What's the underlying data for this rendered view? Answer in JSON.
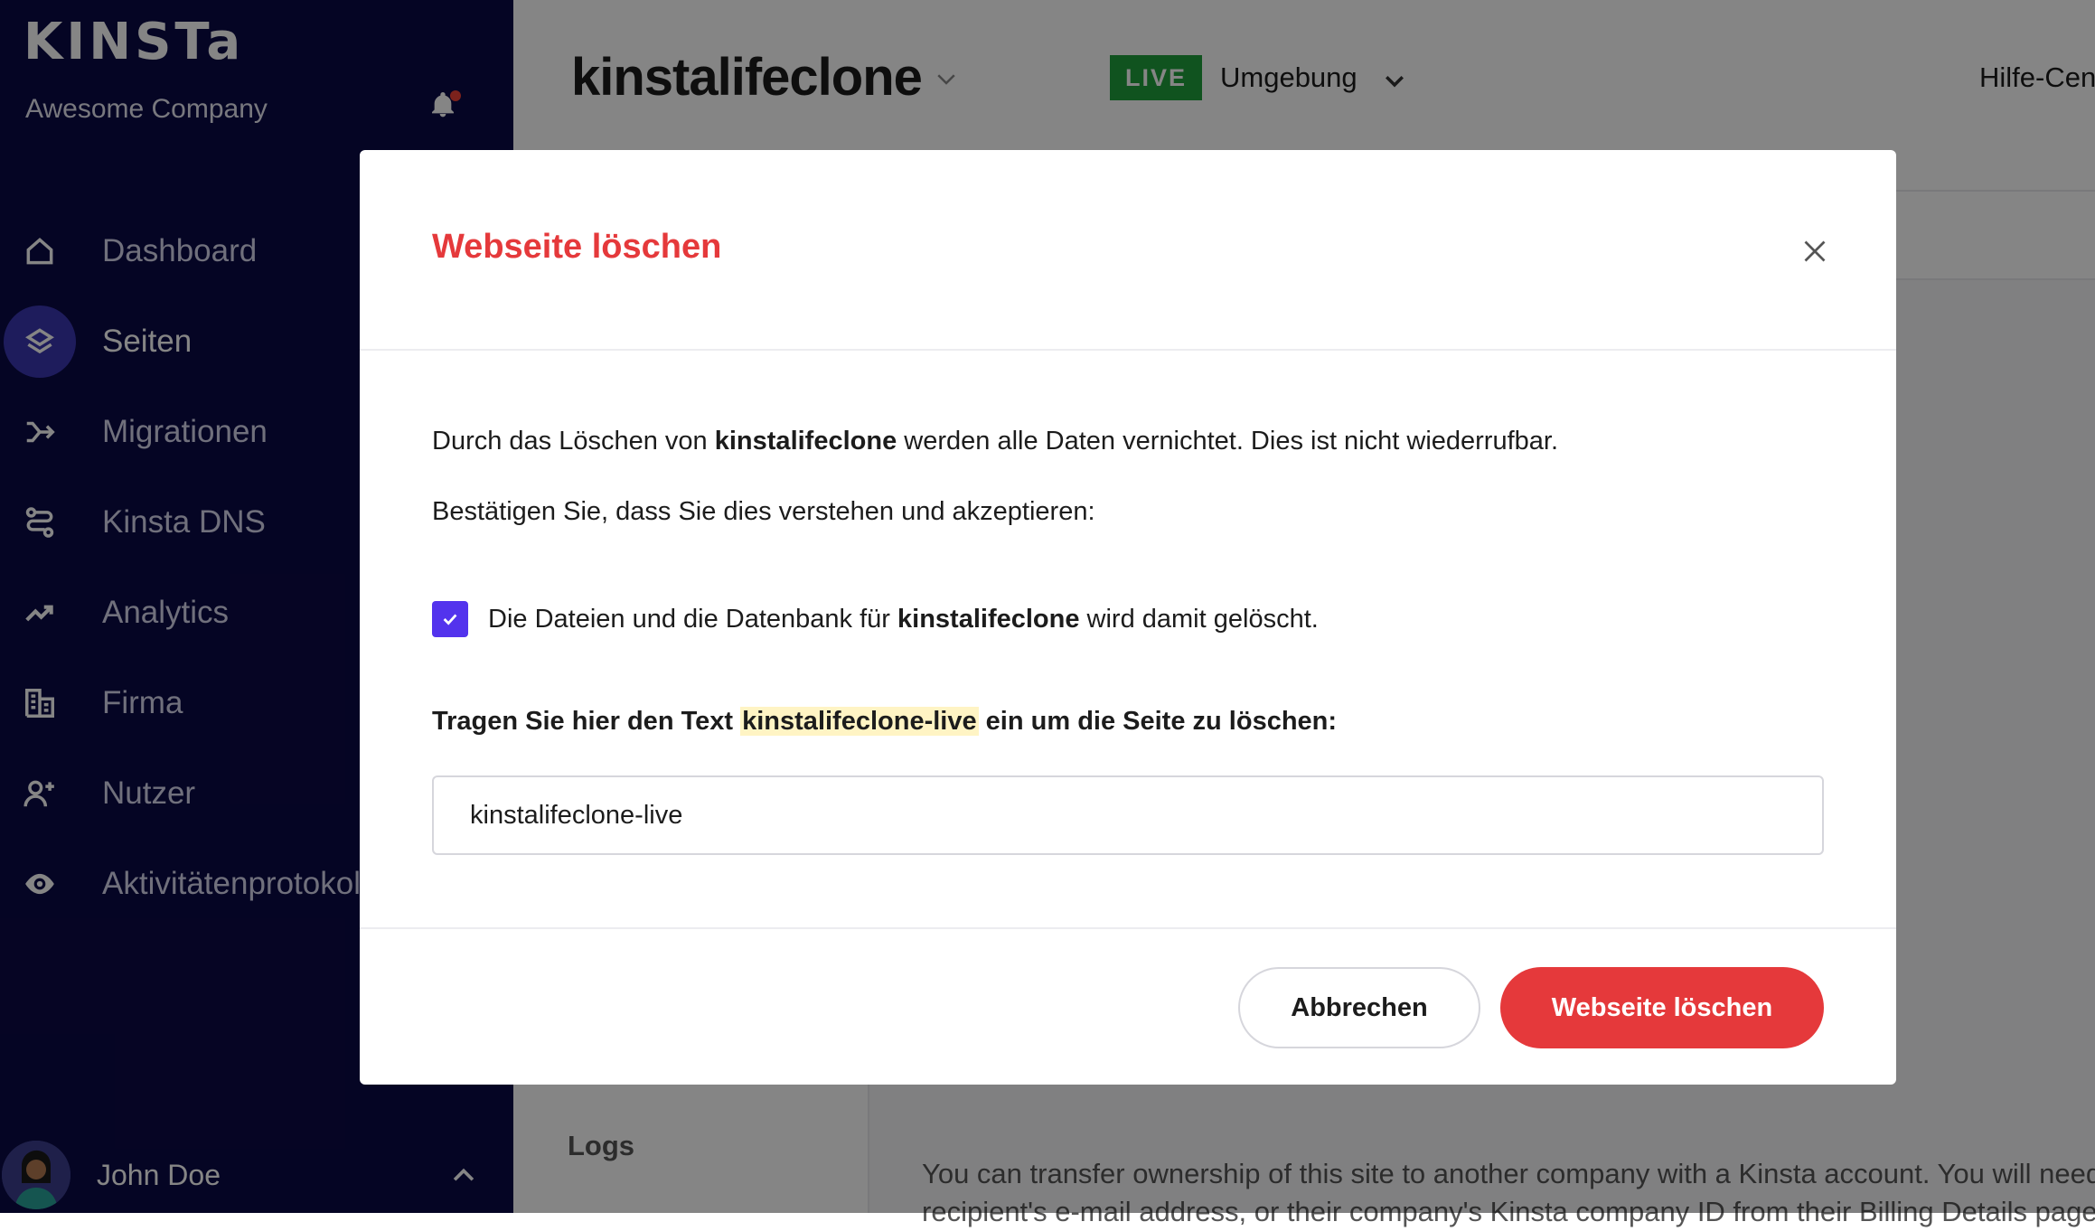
{
  "sidebar": {
    "logo": "KINSTa",
    "company": "Awesome Company",
    "items": [
      {
        "label": "Dashboard",
        "icon": "home-icon",
        "active": false
      },
      {
        "label": "Seiten",
        "icon": "layers-icon",
        "active": true
      },
      {
        "label": "Migrationen",
        "icon": "migration-icon",
        "active": false
      },
      {
        "label": "Kinsta DNS",
        "icon": "dns-icon",
        "active": false
      },
      {
        "label": "Analytics",
        "icon": "analytics-icon",
        "active": false
      },
      {
        "label": "Firma",
        "icon": "building-icon",
        "active": false
      },
      {
        "label": "Nutzer",
        "icon": "add-user-icon",
        "active": false
      },
      {
        "label": "Aktivitätenprotokoll",
        "icon": "eye-icon",
        "active": false
      }
    ],
    "user_name": "John Doe"
  },
  "header": {
    "site_title": "kinstalifeclone",
    "env_badge": "LIVE",
    "env_label": "Umgebung",
    "help": "Hilfe-Center"
  },
  "background": {
    "logs_label": "Logs",
    "transfer_text_line1": "You can transfer ownership of this site to another company with a Kinsta account. You will need the",
    "transfer_text_line2": "recipient's e-mail address, or their company's Kinsta company ID from their Billing Details page."
  },
  "modal": {
    "title": "Webseite löschen",
    "text1_pre": "Durch das Löschen von ",
    "text1_bold": "kinstalifeclone",
    "text1_post": " werden alle Daten vernichtet. Dies ist nicht wiederrufbar.",
    "text2": "Bestätigen Sie, dass Sie dies verstehen und akzeptieren:",
    "checkbox_pre": "Die Dateien und die Datenbank für ",
    "checkbox_bold": "kinstalifeclone",
    "checkbox_post": " wird damit gelöscht.",
    "checkbox_checked": true,
    "confirm_pre": "Tragen Sie hier den Text ",
    "confirm_highlight": "kinstalifeclone-live",
    "confirm_post": " ein um die Seite zu löschen:",
    "input_value": "kinstalifeclone-live",
    "cancel_label": "Abbrechen",
    "delete_label": "Webseite löschen"
  },
  "colors": {
    "sidebar_bg": "#0b0a45",
    "accent_purple": "#5333ed",
    "danger_red": "#e5393b",
    "live_green": "#1f9f3d"
  }
}
